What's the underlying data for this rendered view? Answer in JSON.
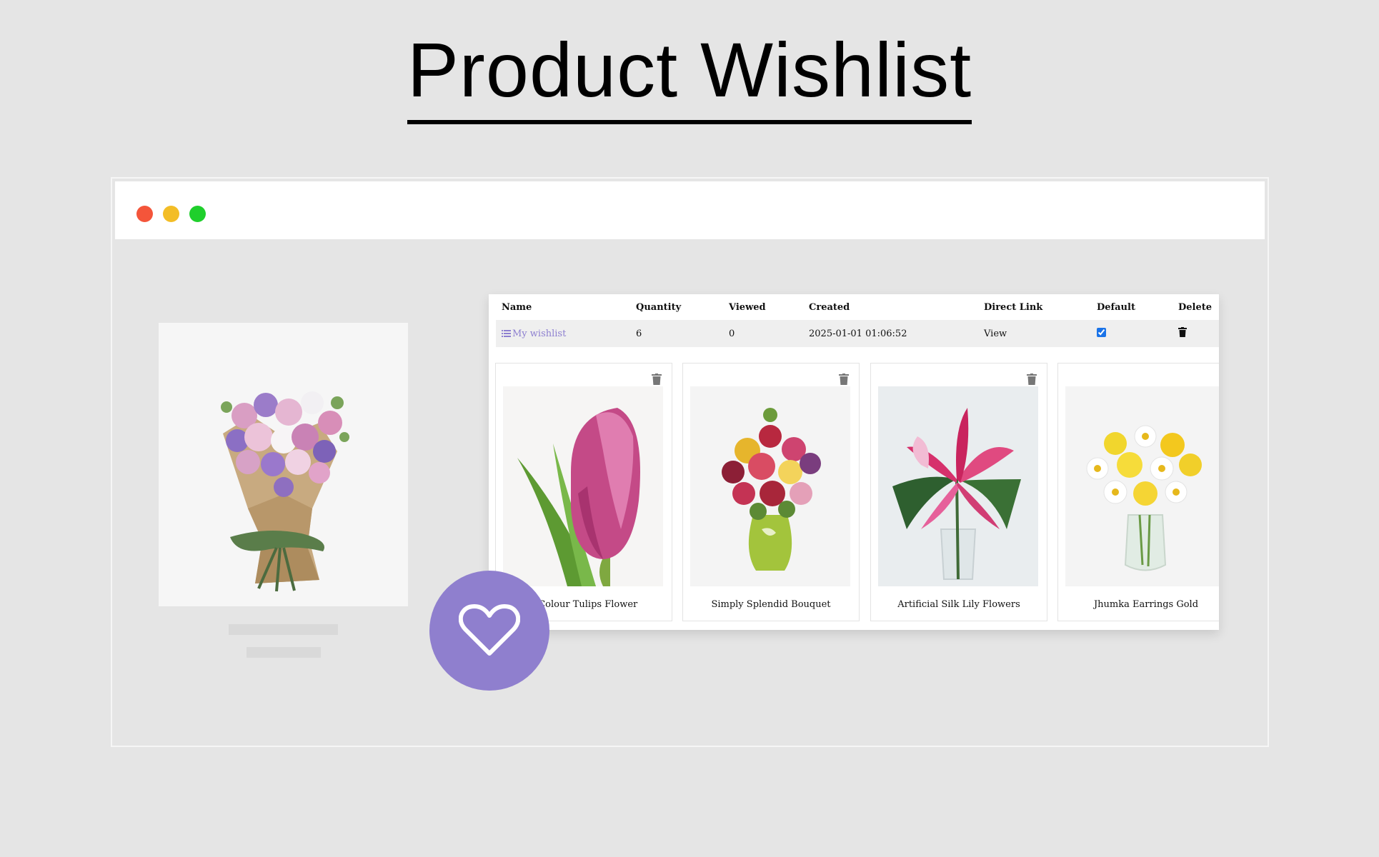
{
  "hero": {
    "title": "Product Wishlist"
  },
  "colors": {
    "page_bg": "#e5e5e5",
    "accent": "#8f7fce",
    "link": "#8d7fd0",
    "window_red": "#f4553a",
    "window_yellow": "#f3bd26",
    "window_green": "#1fcf2c"
  },
  "wishlist_table": {
    "headers": {
      "name": "Name",
      "quantity": "Quantity",
      "viewed": "Viewed",
      "created": "Created",
      "direct_link": "Direct Link",
      "default": "Default",
      "delete": "Delete"
    },
    "row": {
      "name": "My wishlist",
      "quantity": "6",
      "viewed": "0",
      "created": "2025-01-01 01:06:52",
      "direct_link": "View",
      "default_checked": true
    }
  },
  "items": [
    {
      "name": "x Colour Tulips Flower",
      "image": "pink-tulip"
    },
    {
      "name": "Simply Splendid Bouquet",
      "image": "bouquet-vase"
    },
    {
      "name": "Artificial Silk Lily Flowers",
      "image": "pink-lily"
    },
    {
      "name": "Jhumka Earrings Gold",
      "image": "yellow-daisy-vase"
    }
  ],
  "icons": {
    "list": "list-icon",
    "trash": "trash-icon",
    "heart": "heart-icon"
  }
}
